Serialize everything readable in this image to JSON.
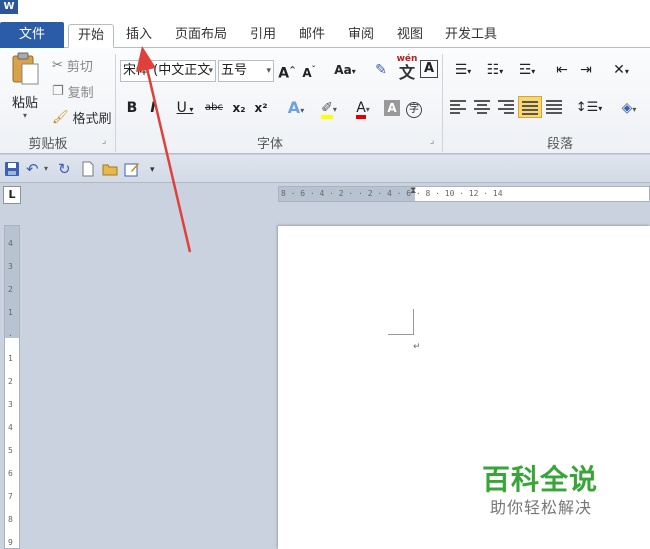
{
  "app": {
    "logo": "W"
  },
  "tabs": [
    {
      "label": "文件"
    },
    {
      "label": "开始"
    },
    {
      "label": "插入"
    },
    {
      "label": "页面布局"
    },
    {
      "label": "引用"
    },
    {
      "label": "邮件"
    },
    {
      "label": "审阅"
    },
    {
      "label": "视图"
    },
    {
      "label": "开发工具"
    }
  ],
  "clipboard": {
    "group_label": "剪贴板",
    "paste_label": "粘贴",
    "cut_label": "剪切",
    "copy_label": "复制",
    "format_painter_label": "格式刷"
  },
  "font": {
    "group_label": "字体",
    "font_name": "宋体 (中文正文",
    "font_size": "五号",
    "grow_icon": "A",
    "shrink_icon": "A",
    "case_label": "Aa",
    "clear_format": "A",
    "bold": "B",
    "italic": "I",
    "underline": "U",
    "strikethrough": "abc",
    "subscript": "x₂",
    "superscript": "x²",
    "text_effect": "A",
    "font_color": "A",
    "char_shading": "A",
    "phonetic_label": "wén",
    "phonetic_char": "文",
    "enclose_char": "字"
  },
  "paragraph": {
    "group_label": "段落"
  },
  "ruler": {
    "h_ticks": "8 · 6 · 4 · 2 · · 2 · 4 · 6 · 8 · 10 · 12 · 14",
    "v_ticks": [
      "4",
      "3",
      "2",
      "1",
      "",
      "1",
      "2",
      "3",
      "4",
      "5",
      "6",
      "7",
      "8",
      "9"
    ]
  },
  "watermark": {
    "title": "百科全说",
    "subtitle": "助你轻松解决"
  },
  "colors": {
    "file_tab": "#2a5ca8",
    "watermark_green": "#37a537",
    "arrow": "#e0403a"
  }
}
